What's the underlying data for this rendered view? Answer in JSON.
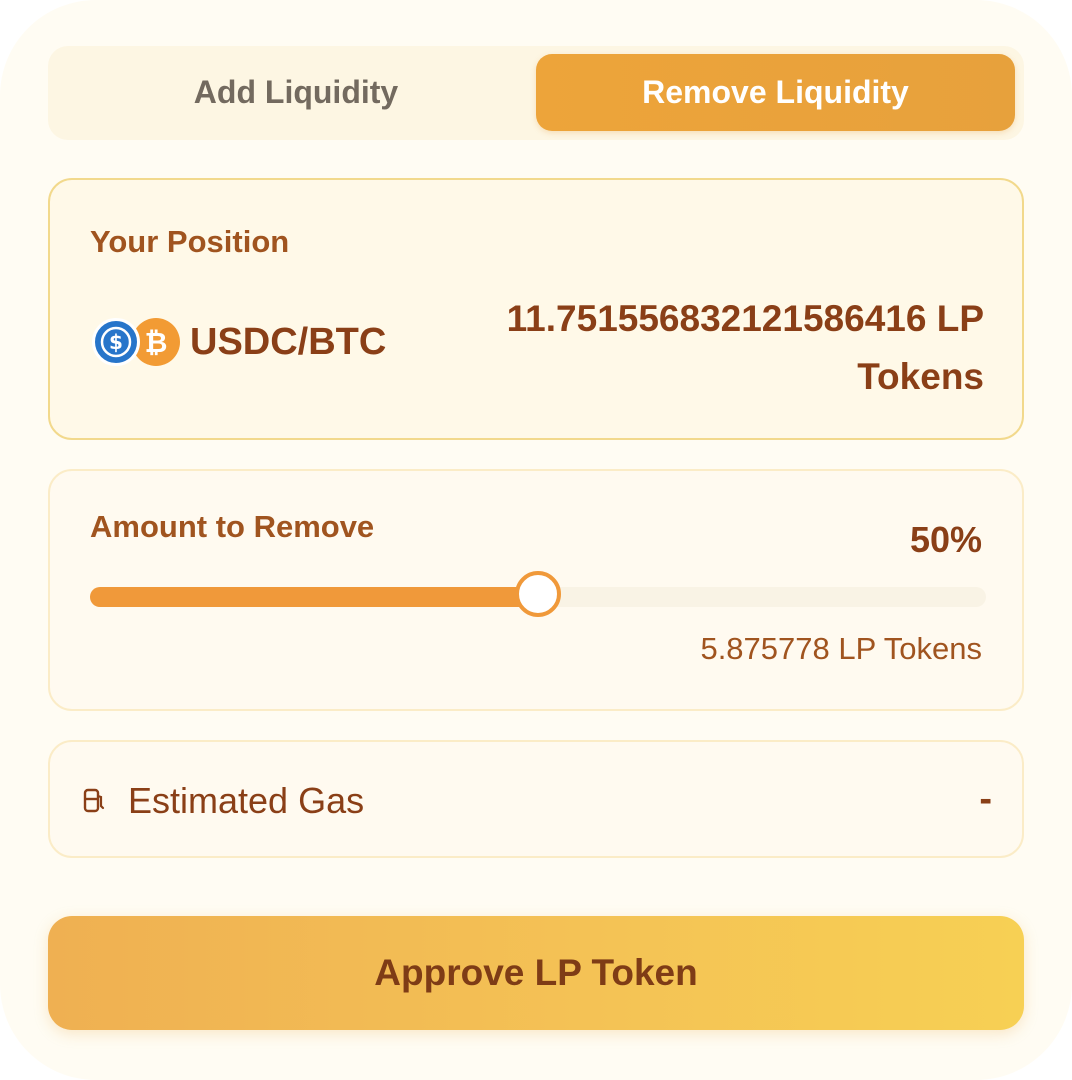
{
  "tabs": {
    "add_label": "Add Liquidity",
    "remove_label": "Remove Liquidity",
    "active": "remove"
  },
  "position": {
    "title": "Your Position",
    "pair_label": "USDC/BTC",
    "lp_balance": "11.7515568321215864​16 LP Tokens"
  },
  "amount": {
    "title": "Amount to Remove",
    "percent_label": "50%",
    "percent_value": 0.5,
    "lp_tokens_label": "5.875778 LP Tokens"
  },
  "gas": {
    "label": "Estimated Gas",
    "value": "-"
  },
  "action": {
    "button_label": "Approve LP Token"
  },
  "icons": {
    "usdc": "usdc-icon",
    "btc": "btc-icon",
    "gas": "gas-pump-icon"
  },
  "colors": {
    "accent": "#f0993a",
    "tab_active": "#eba33b",
    "text_dark": "#8a3f17",
    "text_label": "#a0541f",
    "usdc": "#2775ca",
    "btc": "#f29b34"
  }
}
